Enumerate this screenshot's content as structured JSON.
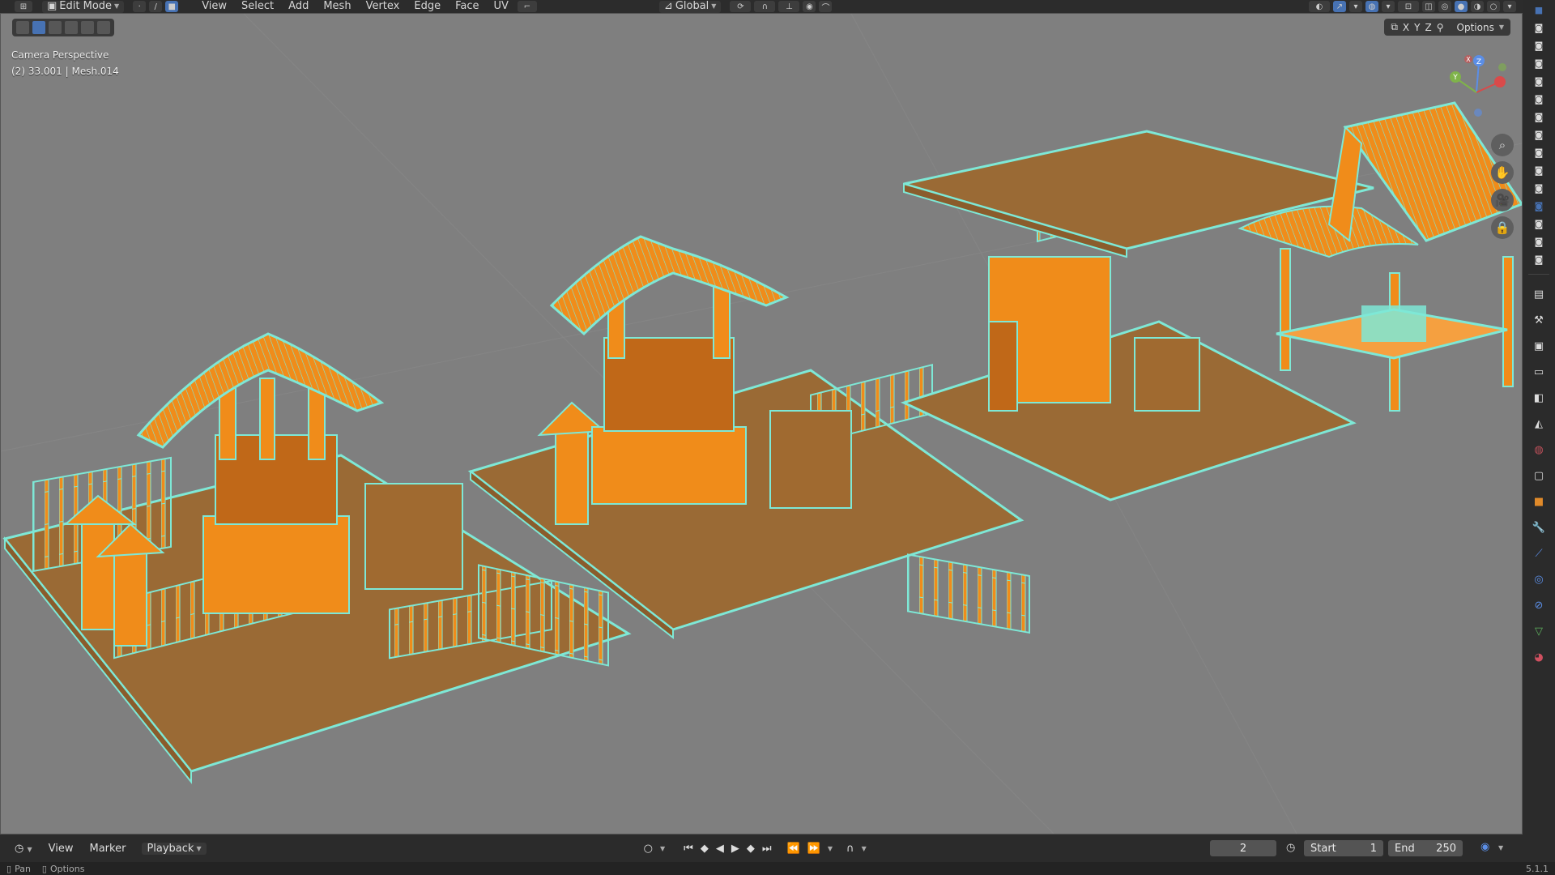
{
  "header": {
    "mode": "Edit Mode",
    "menus": [
      "View",
      "Select",
      "Add",
      "Mesh",
      "Vertex",
      "Edge",
      "Face",
      "UV"
    ],
    "orientation": "Global"
  },
  "viewport": {
    "view_name": "Camera Perspective",
    "object_info": "(2) 33.001 | Mesh.014",
    "axis_labels": [
      "X",
      "Y",
      "Z"
    ],
    "options_label": "Options",
    "gizmo_axes": [
      "Z",
      "X",
      "Y"
    ]
  },
  "timeline": {
    "menus": [
      "View",
      "Marker",
      "Playback"
    ],
    "current_frame": "2",
    "start_label": "Start",
    "start_value": "1",
    "end_label": "End",
    "end_value": "250"
  },
  "statusbar": {
    "left": "Pan",
    "right": "Options",
    "version": "5.1.1"
  },
  "colors": {
    "mesh_face": "#9a6a35",
    "mesh_orange": "#f08c1a",
    "mesh_edge": "#7ee8d6",
    "viewport_bg": "#7f7f7f"
  }
}
